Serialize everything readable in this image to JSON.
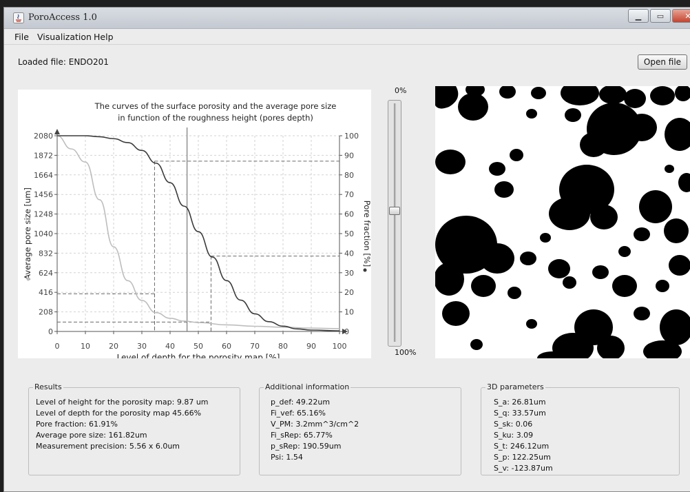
{
  "window": {
    "title": "PoroAccess 1.0",
    "controls": [
      "minimize",
      "maximize",
      "close"
    ]
  },
  "menu": [
    {
      "label": "File"
    },
    {
      "label": "Visualization"
    },
    {
      "label": "Help"
    }
  ],
  "toolbar": {
    "loaded_label": "Loaded file: ENDO201",
    "open_label": "Open file"
  },
  "slider": {
    "top_label": "0%",
    "bottom_label": "100%",
    "value": 0.45
  },
  "chart_data": {
    "type": "line",
    "title": "The curves of the surface porosity and the average pore size",
    "subtitle": "in function of the roughness height (pores depth)",
    "xlabel": "Level of depth for the porosity map [%]",
    "ylabel": "Average pore size [um]",
    "y2label": "Pore fraction [%]",
    "xlim": [
      0,
      100
    ],
    "ylim": [
      0,
      2080
    ],
    "y2lim": [
      0,
      100
    ],
    "xticks": [
      "0",
      "10",
      "20",
      "30",
      "40",
      "50",
      "60",
      "70",
      "80",
      "90",
      "100"
    ],
    "yticks": [
      "0",
      "208",
      "416",
      "624",
      "832",
      "1040",
      "1248",
      "1456",
      "1664",
      "1872",
      "2080"
    ],
    "y2ticks": [
      "0",
      "10",
      "20",
      "30",
      "40",
      "50",
      "60",
      "70",
      "80",
      "90",
      "100"
    ],
    "grid": true,
    "series": [
      {
        "name": "Average pore size",
        "axis": "left",
        "color": "#bdbdbd",
        "x": [
          0,
          5,
          10,
          15,
          20,
          25,
          30,
          35,
          40,
          45,
          50,
          60,
          70,
          80,
          90,
          100
        ],
        "y": [
          2080,
          1940,
          1800,
          1400,
          900,
          540,
          330,
          200,
          140,
          110,
          95,
          70,
          55,
          45,
          35,
          30
        ]
      },
      {
        "name": "Pore fraction",
        "axis": "right",
        "color": "#3a3a3a",
        "x": [
          0,
          5,
          10,
          15,
          20,
          25,
          30,
          35,
          40,
          45,
          50,
          55,
          60,
          65,
          70,
          75,
          80,
          85,
          90,
          100
        ],
        "y": [
          100,
          100,
          100,
          99.5,
          98.5,
          96.5,
          92.5,
          86,
          76,
          64,
          51,
          38,
          26,
          16,
          9,
          5,
          2.7,
          1.3,
          0.7,
          0.3
        ]
      }
    ],
    "annotations": [
      {
        "kind": "vline",
        "x": 46
      },
      {
        "kind": "dashed",
        "x": 34.5,
        "y": 87,
        "axis": "right"
      },
      {
        "kind": "dashed",
        "x": 54.5,
        "y": 38.5,
        "axis": "right"
      },
      {
        "kind": "dashed",
        "x": 34.5,
        "y": 400,
        "axis": "left"
      },
      {
        "kind": "dashed",
        "x": 54.5,
        "y": 100,
        "axis": "left"
      }
    ]
  },
  "panels": {
    "results": {
      "title": "Results",
      "lines": [
        "Level of height for the porosity map: 9.87 um",
        "Level of depth for the porosity map 45.66%",
        "Pore fraction: 61.91%",
        "Average pore size: 161.82um",
        "Measurement precision: 5.56 x 6.0um"
      ]
    },
    "additional": {
      "title": "Additional information",
      "lines": [
        "p_def: 49.22um",
        "Fi_vef: 65.16%",
        "V_PM: 3.2mm^3/cm^2",
        "Fi_sRep: 65.77%",
        "p_sRep: 190.59um",
        "Psi: 1.54"
      ]
    },
    "params3d": {
      "title": "3D parameters",
      "lines": [
        "S_a: 26.81um",
        "S_q: 33.57um",
        "S_sk: 0.06",
        "S_ku: 3.09",
        "S_t: 246.12um",
        "S_p: 122.25um",
        "S_v: -123.87um"
      ]
    }
  }
}
